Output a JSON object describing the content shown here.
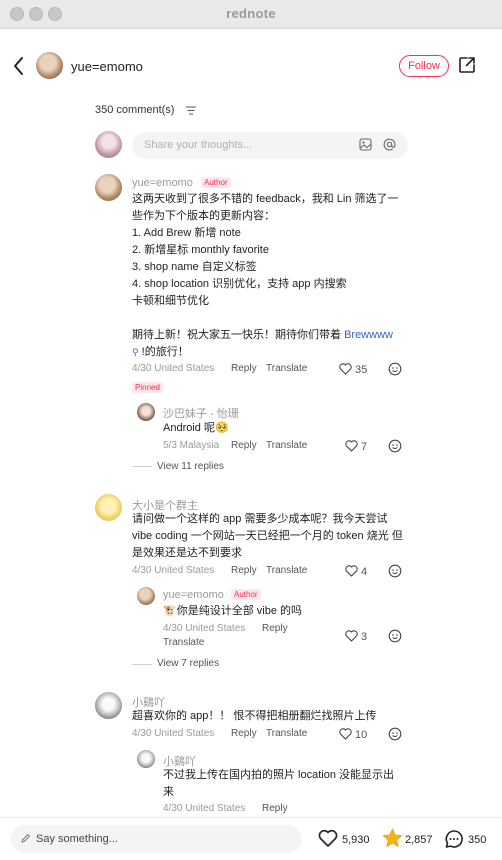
{
  "window": {
    "title": "rednote"
  },
  "header": {
    "username": "yue=emomo",
    "follow_label": "Follow"
  },
  "comments_header": {
    "count_label": "350 comment(s)",
    "input_placeholder": "Share your thoughts..."
  },
  "comments": [
    {
      "author": "yue=emomo",
      "badge": "Author",
      "lines": [
        "这两天收到了很多不错的 feedback，我和 Lin 筛选了一",
        "些作为下个版本的更新内容：",
        "1. Add Brew 新增 note",
        "2. 新增星标 monthly favorite",
        "3. shop name 自定义标签",
        "4. shop location 识别优化，支持 app 内搜索",
        "卡顿和细节优化",
        "",
        "期待上新！祝大家五一快乐！期待你们带着 "
      ],
      "link_text": "Brewwww",
      "after_link": "!的旅行！",
      "meta": "4/30 United States",
      "reply": "Reply",
      "translate": "Translate",
      "likes": "35",
      "pinned": "Pinned",
      "replies": [
        {
          "author": "沙巴妹子 - 怡珊",
          "text": "Android 呢🥺",
          "meta": "5/3 Malaysia",
          "reply": "Reply",
          "translate": "Translate",
          "likes": "7"
        }
      ],
      "view_replies": "View 11 replies"
    },
    {
      "author": "大小是个群主",
      "lines": [
        "请问做一个这样的 app 需要多少成本呢？我今天尝试",
        "vibe coding 一个网站一天已经把一个月的 token 烧光 但",
        "是效果还是达不到要求"
      ],
      "meta": "4/30 United States",
      "reply": "Reply",
      "translate": "Translate",
      "likes": "4",
      "replies": [
        {
          "author": "yue=emomo",
          "badge": "Author",
          "text": "🐮你是纯设计全部 vibe 的吗",
          "meta": "4/30 United States",
          "reply": "Reply",
          "translate": "Translate",
          "likes": "3"
        }
      ],
      "view_replies": "View 7 replies"
    },
    {
      "author": "小鷄吖",
      "lines": [
        "超喜欢你的 app！！ 恨不得把相册翻烂找照片上传"
      ],
      "meta": "4/30 United States",
      "reply": "Reply",
      "translate": "Translate",
      "likes": "10",
      "replies": [
        {
          "author": "小鷄吖",
          "lines": [
            "不过我上传在国内拍的照片 location 没能显示出",
            "来"
          ],
          "meta": "4/30 United States",
          "reply": "Reply"
        }
      ]
    }
  ],
  "bottom_bar": {
    "placeholder": "Say something...",
    "likes": "5,930",
    "stars": "2,857",
    "comments": "350"
  },
  "colors": {
    "accent": "#ff2e4d",
    "link": "#3a64b8",
    "star": "#f6b21a"
  },
  "icons": [
    "back-icon",
    "share-icon",
    "sort-icon",
    "image-icon",
    "at-icon",
    "heart-icon",
    "smiley-icon",
    "pencil-icon",
    "star-icon",
    "comment-icon"
  ]
}
